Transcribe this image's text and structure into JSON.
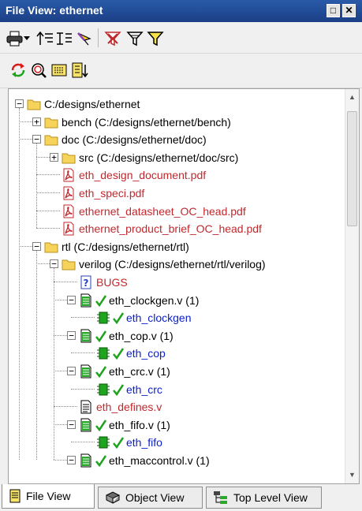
{
  "window": {
    "title": "File View: ethernet",
    "restore_glyph": "□",
    "close_glyph": "✕"
  },
  "tree": [
    {
      "id": "root",
      "label": "C:/designs/ethernet",
      "icon": "folder-icon",
      "color": "black",
      "expander": "−"
    },
    {
      "id": "bench",
      "label": "bench (C:/designs/ethernet/bench)",
      "icon": "folder-icon",
      "color": "black",
      "expander": "+"
    },
    {
      "id": "doc",
      "label": "doc (C:/designs/ethernet/doc)",
      "icon": "folder-icon",
      "color": "black",
      "expander": "−"
    },
    {
      "id": "src",
      "label": "src (C:/designs/ethernet/doc/src)",
      "icon": "folder-icon",
      "color": "black",
      "expander": "+"
    },
    {
      "id": "pdf1",
      "label": "eth_design_document.pdf",
      "icon": "pdf-file-icon",
      "color": "red"
    },
    {
      "id": "pdf2",
      "label": "eth_speci.pdf",
      "icon": "pdf-file-icon",
      "color": "red"
    },
    {
      "id": "pdf3",
      "label": "ethernet_datasheet_OC_head.pdf",
      "icon": "pdf-file-icon",
      "color": "red"
    },
    {
      "id": "pdf4",
      "label": "ethernet_product_brief_OC_head.pdf",
      "icon": "pdf-file-icon",
      "color": "red"
    },
    {
      "id": "rtl",
      "label": "rtl (C:/designs/ethernet/rtl)",
      "icon": "folder-icon",
      "color": "black",
      "expander": "−"
    },
    {
      "id": "verilog",
      "label": "verilog (C:/designs/ethernet/rtl/verilog)",
      "icon": "folder-icon",
      "color": "black",
      "expander": "−"
    },
    {
      "id": "bugs",
      "label": "BUGS",
      "icon": "unknown-file-icon",
      "color": "red"
    },
    {
      "id": "clkgen_v",
      "label": "eth_clockgen.v (1)",
      "icon": "verilog-file-icon",
      "check": true,
      "color": "black",
      "expander": "−"
    },
    {
      "id": "clkgen",
      "label": "eth_clockgen",
      "icon": "module-icon",
      "check": true,
      "color": "blue"
    },
    {
      "id": "cop_v",
      "label": "eth_cop.v (1)",
      "icon": "verilog-file-icon",
      "check": true,
      "color": "black",
      "expander": "−"
    },
    {
      "id": "cop",
      "label": "eth_cop",
      "icon": "module-icon",
      "check": true,
      "color": "blue"
    },
    {
      "id": "crc_v",
      "label": "eth_crc.v (1)",
      "icon": "verilog-file-icon",
      "check": true,
      "color": "black",
      "expander": "−"
    },
    {
      "id": "crc",
      "label": "eth_crc",
      "icon": "module-icon",
      "check": true,
      "color": "blue"
    },
    {
      "id": "defines",
      "label": "eth_defines.v",
      "icon": "text-file-icon",
      "color": "red"
    },
    {
      "id": "fifo_v",
      "label": "eth_fifo.v (1)",
      "icon": "verilog-file-icon",
      "check": true,
      "color": "black",
      "expander": "−"
    },
    {
      "id": "fifo",
      "label": "eth_fifo",
      "icon": "module-icon",
      "check": true,
      "color": "blue"
    },
    {
      "id": "macctl_v",
      "label": "eth_maccontrol.v (1)",
      "icon": "verilog-file-icon",
      "check": true,
      "color": "black",
      "expander": "−"
    }
  ],
  "tabs": [
    {
      "label": "File View",
      "icon": "file-view-icon",
      "active": true
    },
    {
      "label": "Object View",
      "icon": "object-view-icon",
      "active": false
    },
    {
      "label": "Top Level View",
      "icon": "hierarchy-icon",
      "active": false
    }
  ]
}
